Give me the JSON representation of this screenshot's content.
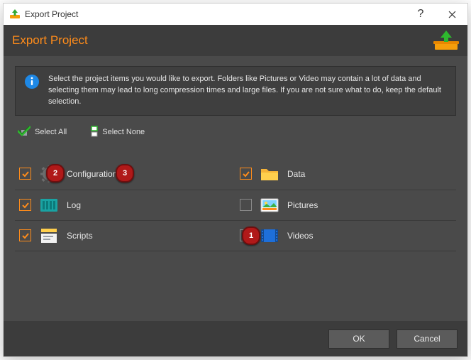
{
  "titlebar": {
    "title": "Export Project",
    "help": "?"
  },
  "header": {
    "heading": "Export Project"
  },
  "info": {
    "text": "Select the project items you would like to export. Folders like Pictures or Video may contain a lot of data and selecting them may lead to long compression times and large files. If you are not sure what to do, keep the default selection."
  },
  "controls": {
    "select_all": "Select All",
    "select_none": "Select None"
  },
  "items": [
    {
      "label": "Configurations",
      "checked": true
    },
    {
      "label": "Data",
      "checked": true
    },
    {
      "label": "Log",
      "checked": true
    },
    {
      "label": "Pictures",
      "checked": false
    },
    {
      "label": "Scripts",
      "checked": true
    },
    {
      "label": "Videos",
      "checked": false
    }
  ],
  "annotations": [
    {
      "num": "1"
    },
    {
      "num": "2"
    },
    {
      "num": "3"
    }
  ],
  "footer": {
    "ok": "OK",
    "cancel": "Cancel"
  },
  "colors": {
    "accent": "#ff8c1a",
    "body_bg": "#4a4a4a",
    "header_bg": "#3c3c3c"
  }
}
